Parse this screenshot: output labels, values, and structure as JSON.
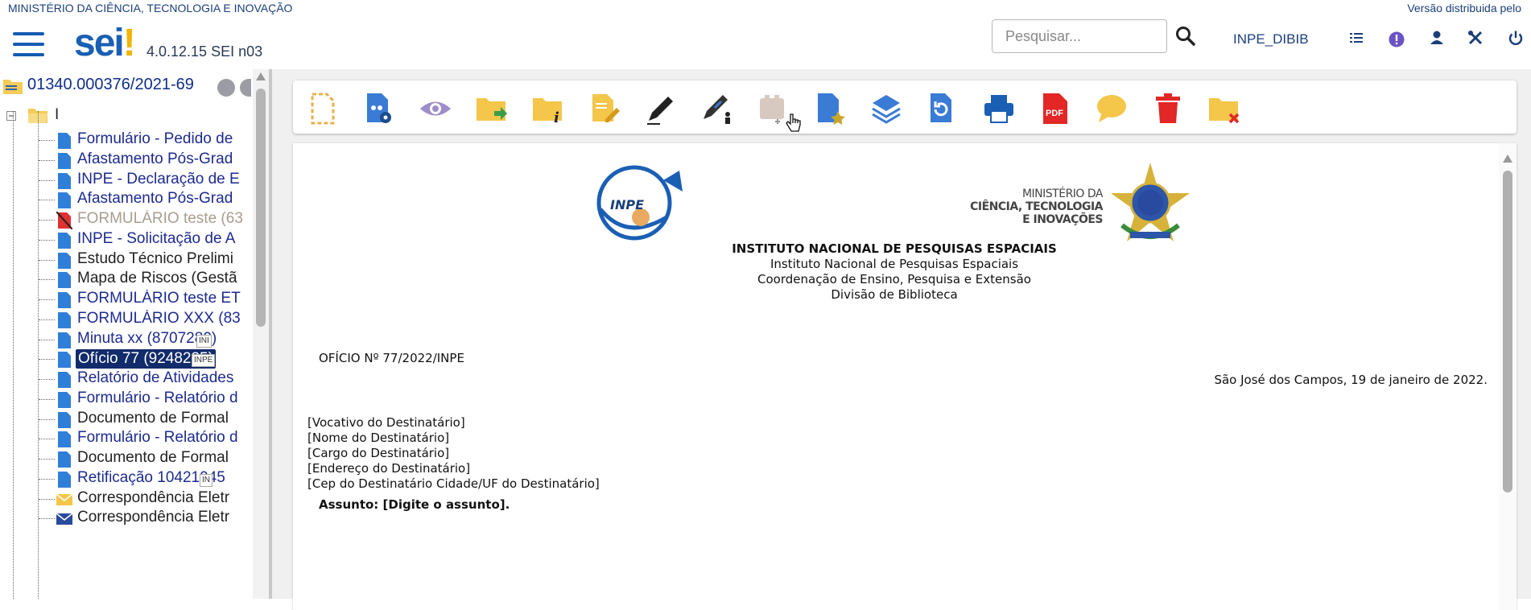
{
  "header": {
    "ministry": "MINISTÉRIO DA CIÊNCIA, TECNOLOGIA E INOVAÇÃO",
    "version_notice": "Versão distribuida pelo",
    "logo_text": "sei",
    "logo_bang": "!",
    "system_version": "4.0.12.15 SEI n03",
    "search_placeholder": "Pesquisar...",
    "unit": "INPE_DIBIB",
    "icons": [
      "menu-icon",
      "search-icon",
      "list-icon",
      "info-icon",
      "user-icon",
      "tools-icon",
      "power-icon"
    ]
  },
  "tree": {
    "process_number": "01340.000376/2021-69",
    "folder_label": "I",
    "items": [
      {
        "text": "Formulário - Pedido de",
        "style": "link"
      },
      {
        "text": "Afastamento Pós-Grad",
        "style": "link"
      },
      {
        "text": "INPE - Declaração de E",
        "style": "link"
      },
      {
        "text": "Afastamento Pós-Grad",
        "style": "link"
      },
      {
        "text": "FORMULÁRIO teste (63",
        "style": "grey"
      },
      {
        "text": "INPE - Solicitação de A",
        "style": "link"
      },
      {
        "text": "Estudo Técnico Prelimi",
        "style": "dark"
      },
      {
        "text": "Mapa de Riscos (Gestã",
        "style": "dark"
      },
      {
        "text": "FORMULÁRIO teste ET",
        "style": "link"
      },
      {
        "text": "FORMULÁRIO XXX (83",
        "style": "link"
      },
      {
        "text": "Minuta xx (8707280)",
        "style": "link",
        "badge": "INI"
      },
      {
        "text": "Ofício 77 (9248235)",
        "style": "sel",
        "badge": "INPE"
      },
      {
        "text": "Relatório de Atividades",
        "style": "link"
      },
      {
        "text": "Formulário - Relatório d",
        "style": "link"
      },
      {
        "text": "Documento de Formal",
        "style": "dark"
      },
      {
        "text": "Formulário - Relatório d",
        "style": "link"
      },
      {
        "text": "Documento de Formal",
        "style": "dark"
      },
      {
        "text": "Retificação 10421945",
        "style": "link",
        "badge": "IN"
      },
      {
        "text": "Correspondência Eletr",
        "style": "dark",
        "icon": "envelope-open"
      },
      {
        "text": "Correspondência Eletr",
        "style": "dark",
        "icon": "envelope"
      }
    ]
  },
  "toolbar": {
    "icons": [
      "new-document-icon",
      "document-settings-icon",
      "view-icon",
      "move-folder-icon",
      "folder-info-icon",
      "edit-document-icon",
      "sign-icon",
      "sign-block-icon",
      "attach-icon",
      "favorite-document-icon",
      "layers-icon",
      "refresh-document-icon",
      "print-icon",
      "pdf-icon",
      "comment-icon",
      "delete-icon",
      "folder-remove-icon"
    ]
  },
  "document": {
    "inpe_logo_text": "INPE",
    "ministerio_line1": "MINISTÉRIO DA",
    "ministerio_line2": "CIÊNCIA, TECNOLOGIA",
    "ministerio_line3": "E INOVAÇÕES",
    "institute_bold": "INSTITUTO NACIONAL DE PESQUISAS ESPACIAIS",
    "institute": "Instituto Nacional de Pesquisas Espaciais",
    "coordination": "Coordenação de Ensino, Pesquisa e Extensão",
    "division": "Divisão de Biblioteca",
    "oficio": "OFÍCIO Nº 77/2022/INPE",
    "date_line": "São José dos Campos, 19 de janeiro de 2022.",
    "recipient": [
      "[Vocativo do Destinatário]",
      "[Nome do Destinatário]",
      "[Cargo do Destinatário]",
      "[Endereço do Destinatário]",
      "[Cep do Destinatário Cidade/UF do Destinatário]"
    ],
    "subject": "Assunto: [Digite o assunto]."
  },
  "colors": {
    "primary_blue": "#155bb4",
    "link_blue": "#1d2b8f",
    "selected_bg": "#122b6b",
    "folder_yellow": "#f4cc5a",
    "pdf_red": "#e32626",
    "delete_red": "#e32626"
  }
}
